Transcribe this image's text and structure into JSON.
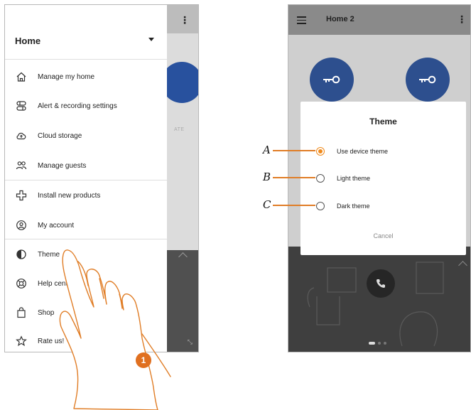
{
  "left_screen": {
    "drawer": {
      "title": "Home",
      "items": [
        {
          "label": "Manage my home",
          "icon": "house-icon"
        },
        {
          "label": "Alert & recording settings",
          "icon": "alert-settings-icon"
        },
        {
          "label": "Cloud storage",
          "icon": "cloud-icon"
        },
        {
          "label": "Manage guests",
          "icon": "guests-icon"
        },
        {
          "label": "Install new products",
          "icon": "install-icon"
        },
        {
          "label": "My account",
          "icon": "account-icon"
        },
        {
          "label": "Theme",
          "icon": "theme-icon"
        },
        {
          "label": "Help center",
          "icon": "help-icon"
        },
        {
          "label": "Shop",
          "icon": "shop-icon"
        },
        {
          "label": "Rate us!",
          "icon": "star-icon"
        }
      ]
    },
    "background_fragment": "ATE",
    "step_number": "1"
  },
  "right_screen": {
    "header": {
      "title": "Home 2"
    },
    "dialog": {
      "title": "Theme",
      "options": [
        {
          "label": "Use device theme",
          "selected": true,
          "callout": "A"
        },
        {
          "label": "Light theme",
          "selected": false,
          "callout": "B"
        },
        {
          "label": "Dark theme",
          "selected": false,
          "callout": "C"
        }
      ],
      "cancel_label": "Cancel"
    }
  },
  "colors": {
    "accent_orange": "#f08a1c",
    "key_button_blue": "#2d4f8e"
  }
}
